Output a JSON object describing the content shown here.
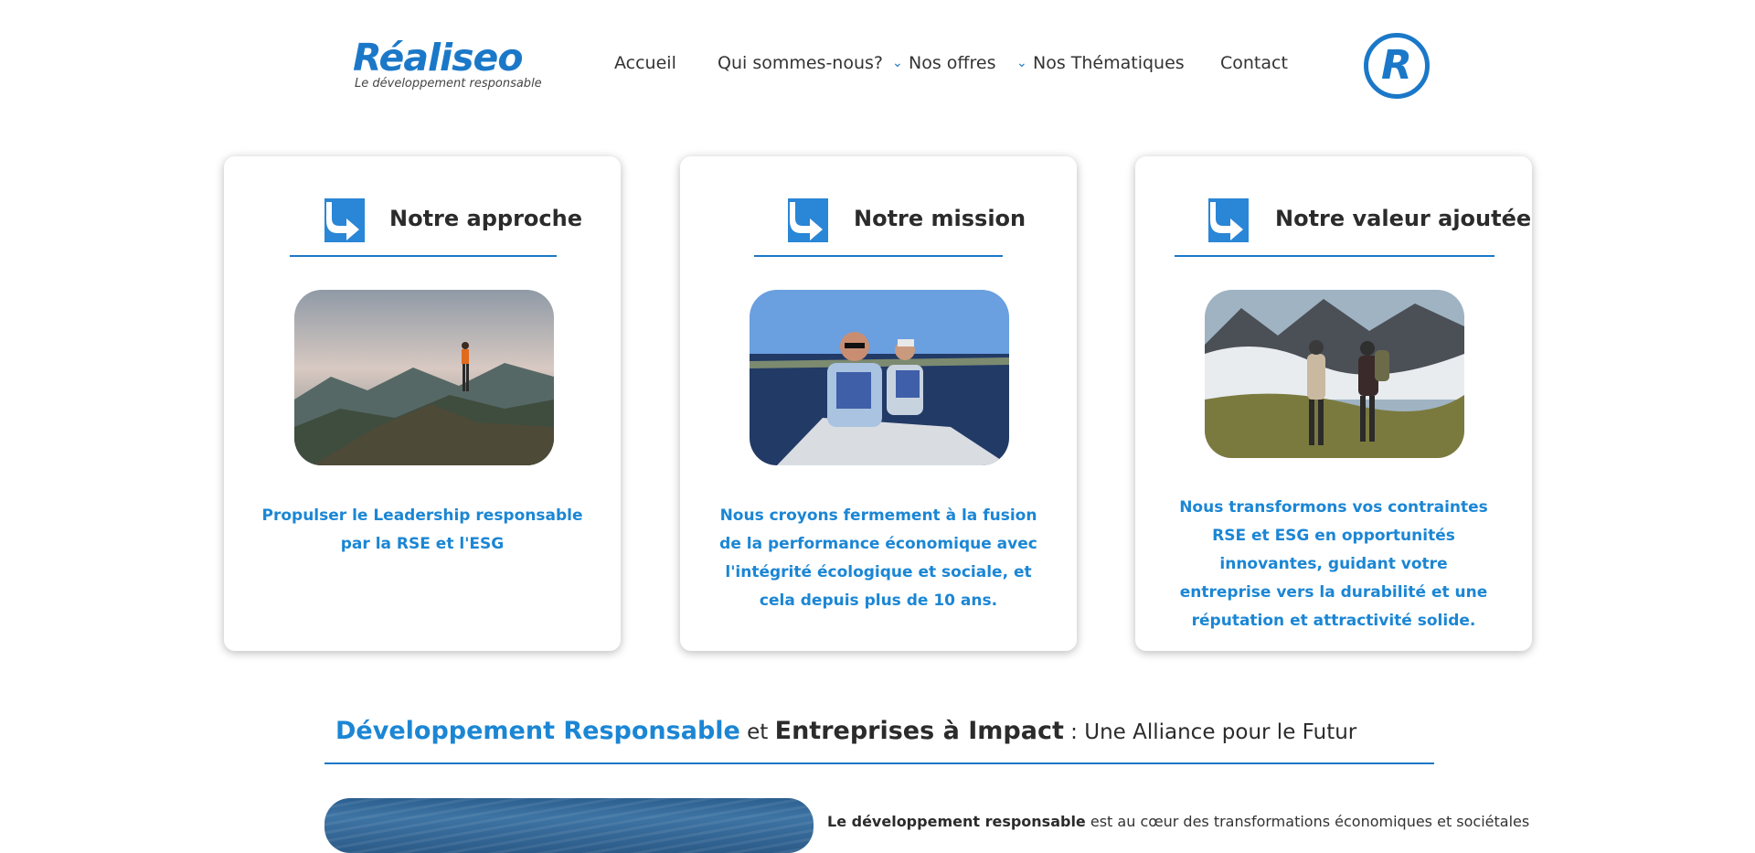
{
  "brand": {
    "name": "Réaliseo",
    "tagline": "Le développement responsable",
    "badge_letter": "R"
  },
  "nav": {
    "items": [
      {
        "label": "Accueil",
        "has_dropdown": false
      },
      {
        "label": "Qui sommes-nous?",
        "has_dropdown": false
      },
      {
        "label": "Nos offres",
        "has_dropdown": true
      },
      {
        "label": "Nos Thématiques",
        "has_dropdown": true
      },
      {
        "label": "Contact",
        "has_dropdown": false
      }
    ]
  },
  "cards": [
    {
      "title": "Notre approche",
      "image": "hiker-on-mountain-summit",
      "text": "Propulser le Leadership responsable par la RSE et l'ESG"
    },
    {
      "title": "Notre mission",
      "image": "people-rowing-boat-on-lake",
      "text": "Nous croyons fermement à la fusion de la performance économique avec l'intégrité écologique et sociale, et cela depuis plus de 10 ans."
    },
    {
      "title": "Notre valeur ajoutée",
      "image": "two-hikers-above-clouds",
      "text": "Nous transformons vos contraintes RSE et ESG en opportunités innovantes, guidant votre entreprise vers la durabilité et une réputation et attractivité solide."
    }
  ],
  "section": {
    "title_part1": "Développement Responsable",
    "title_joiner": " et ",
    "title_part2": "Entreprises à Impact",
    "title_part3": " : Une Alliance pour le Futur",
    "intro_bold": "Le développement responsable",
    "intro_rest": " est au cœur des transformations économiques et sociétales"
  },
  "colors": {
    "accent": "#1b78c8",
    "text_blue": "#1b86d4",
    "heading": "#2b2b2b"
  },
  "icons": [
    "chevron-down-icon",
    "arrow-turn-icon"
  ]
}
